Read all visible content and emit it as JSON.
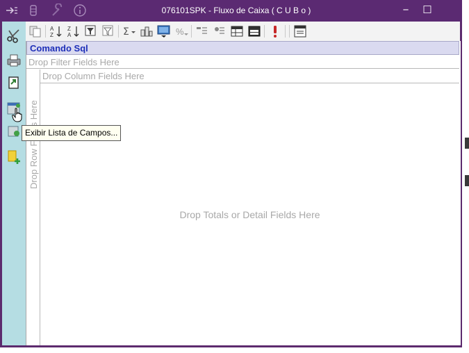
{
  "window": {
    "title": "076101SPK - Fluxo de Caixa ( C U B o )",
    "minimize_glyph": "−",
    "maximize_glyph": "☐"
  },
  "titlebar_icons": [
    "pin-arrow-icon",
    "settings-icon",
    "wrench-icon",
    "info-icon"
  ],
  "sidebar": {
    "items": [
      "scissors-icon",
      "print-icon",
      "export-icon",
      "field-list-icon",
      "refresh-icon",
      "add-icon"
    ]
  },
  "toolbar": {
    "items": [
      "copy-icon",
      "sort-asc-icon",
      "sort-desc-icon",
      "filter-icon",
      "filter-clear-icon",
      "sum-icon",
      "chart-icon",
      "display-icon",
      "percent-icon",
      "expand-icon",
      "collapse-icon",
      "grid-icon",
      "grid-dark-icon",
      "alert-icon",
      "export-doc-icon"
    ]
  },
  "pivot": {
    "command_header": "Comando Sql",
    "filter_placeholder": "Drop Filter Fields Here",
    "column_placeholder": "Drop Column Fields Here",
    "row_placeholder": "Drop Row Fields Here",
    "totals_placeholder": "Drop Totals or Detail Fields Here"
  },
  "tooltip": {
    "text": "Exibir Lista de Campos..."
  },
  "colors": {
    "titlebar": "#5b2a72",
    "sidebar": "#b5dde3",
    "header_fill": "#dadaf0",
    "header_text": "#1e2fb8"
  }
}
